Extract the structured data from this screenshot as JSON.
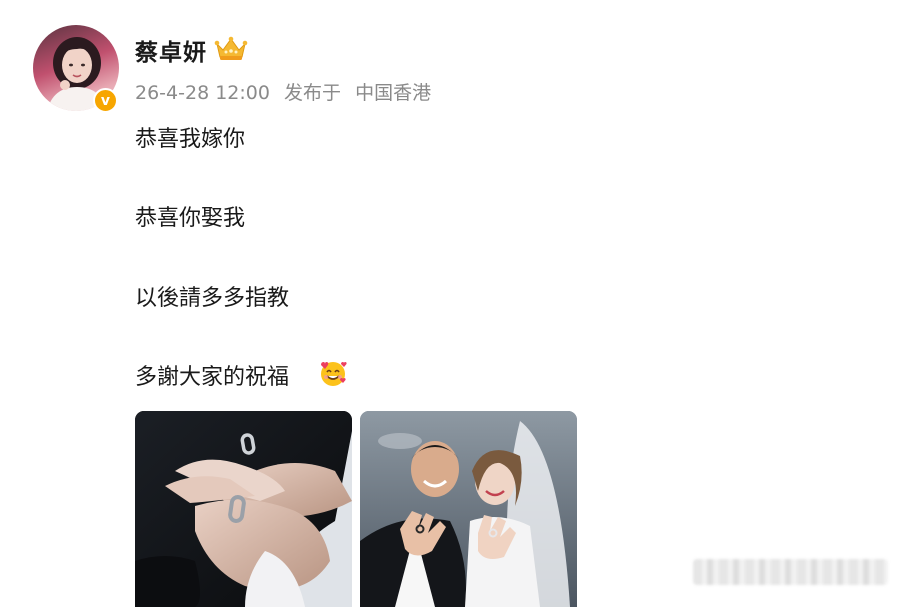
{
  "user": {
    "name": "蔡卓妍",
    "avatar_icon": "profile-photo",
    "verified_icon": "verified-v-icon",
    "verified_mark": "v",
    "badge_icon": "crown-member-icon",
    "accent": "#f7a600"
  },
  "post": {
    "timestamp": "26-4-28 12:00",
    "location_prefix": "发布于",
    "location": "中国香港",
    "lines": [
      "恭喜我嫁你",
      "恭喜你娶我",
      "以後請多多指教",
      "多謝大家的祝福"
    ],
    "emoji_icon": "smiling-face-with-hearts-icon",
    "images": [
      {
        "icon": "photo-hands-with-rings"
      },
      {
        "icon": "photo-wedding-couple"
      }
    ]
  },
  "watermark_icon": "blurred-watermark"
}
